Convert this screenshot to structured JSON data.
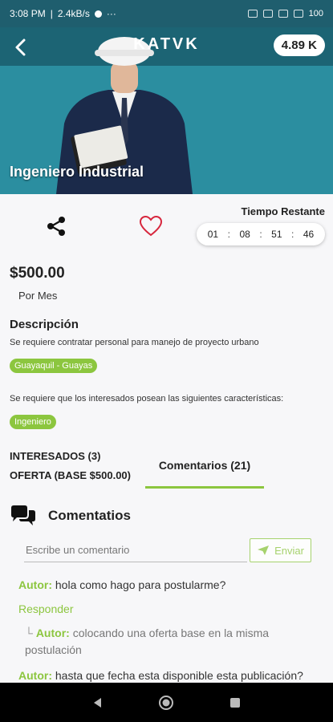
{
  "status": {
    "time": "3:08 PM",
    "speed": "2.4kB/s",
    "dots": "···",
    "battery": "100"
  },
  "header": {
    "brand": "KATVK",
    "rating": "4.89 K",
    "colors": {
      "bar": "#1c6474",
      "accent": "#8cc63f"
    }
  },
  "job": {
    "title": "Ingeniero Industrial",
    "price": "$500.00",
    "period": "Por Mes",
    "description_title": "Descripción",
    "description": "Se requiere contratar personal para manejo de proyecto urbano",
    "location_tag": "Guayaquil - Guayas",
    "requirements_text": "Se requiere que los interesados posean las siguientes características:",
    "skill_tag": "Ingeniero"
  },
  "timer": {
    "label": "Tiempo Restante",
    "days": "01",
    "hours": "08",
    "minutes": "51",
    "seconds": "46",
    "separator": ":"
  },
  "tabs": {
    "interesados": "INTERESADOS (3)",
    "oferta": "OFERTA (BASE $500.00)",
    "comments": "Comentarios (21)"
  },
  "comments": {
    "section_title": "Comentatios",
    "input_placeholder": "Escribe un comentario",
    "send_label": "Enviar",
    "reply_label": "Responder",
    "items": [
      {
        "author": "Autor:",
        "text": " hola como hago para postularme?"
      },
      {
        "prefix": "└",
        "author": "Autor:",
        "text": " colocando una oferta base en la misma postulación"
      },
      {
        "author": "Autor:",
        "text": " hasta que fecha esta disponible esta publicación?"
      }
    ]
  },
  "icons": {
    "back": "arrow-left-icon",
    "share": "share-icon",
    "favorite": "heart-icon",
    "comments": "chat-bubbles-icon",
    "send": "paper-plane-icon"
  }
}
